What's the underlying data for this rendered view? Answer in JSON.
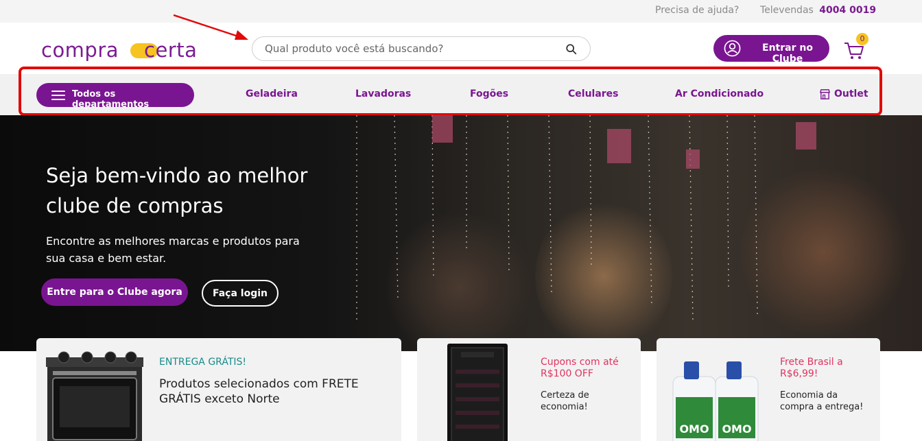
{
  "topbar": {
    "help_text": "Precisa de ajuda?",
    "televendas_label": "Televendas",
    "televendas_number": "4004 0019"
  },
  "header": {
    "logo_part1": "compra",
    "logo_part2": "certa",
    "search_placeholder": "Qual produto você está buscando?",
    "club_button": "Entrar no Clube",
    "cart_count": "0"
  },
  "nav": {
    "departments_button": "Todos os departamentos",
    "links": [
      "Geladeira",
      "Lavadoras",
      "Fogões",
      "Celulares",
      "Ar Condicionado",
      "Outlet"
    ]
  },
  "hero": {
    "title": "Seja bem-vindo ao melhor clube de compras",
    "subtitle": "Encontre as melhores marcas e produtos para sua casa e bem estar.",
    "primary_button": "Entre para o Clube agora",
    "secondary_button": "Faça login"
  },
  "cards": [
    {
      "tag": "ENTREGA GRÁTIS!",
      "text": "Produtos selecionados com FRETE GRÁTIS exceto Norte",
      "tag_color": "#1a8a8a"
    },
    {
      "tag": "Cupons com até R$100 OFF",
      "text": "Certeza de economia!",
      "tag_color": "#e0335f"
    },
    {
      "tag": "Frete Brasil a R$6,99!",
      "text": "Economia da compra a entrega!",
      "tag_color": "#e0335f"
    }
  ],
  "colors": {
    "brand_purple": "#7a1591",
    "brand_yellow": "#f6c320",
    "annotation_red": "#e10a0a"
  },
  "icons": {
    "search": "search-icon",
    "user": "user-icon",
    "cart": "cart-icon",
    "menu": "hamburger-menu-icon",
    "outlet": "store-icon"
  }
}
